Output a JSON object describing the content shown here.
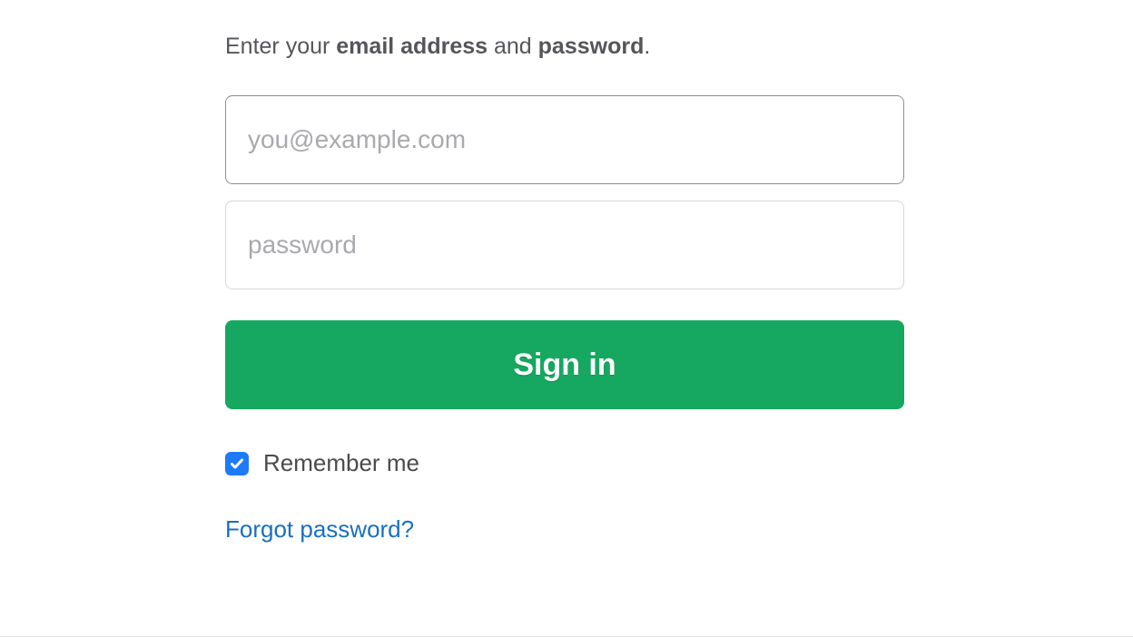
{
  "instruction": {
    "prefix": "Enter your ",
    "bold1": "email address",
    "mid": " and ",
    "bold2": "password",
    "suffix": "."
  },
  "email": {
    "placeholder": "you@example.com",
    "value": ""
  },
  "password": {
    "placeholder": "password",
    "value": ""
  },
  "signin_label": "Sign in",
  "remember": {
    "label": "Remember me",
    "checked": true
  },
  "forgot_label": "Forgot password?",
  "colors": {
    "primary_button": "#16a860",
    "checkbox": "#1d7af9",
    "link": "#1870c2"
  }
}
